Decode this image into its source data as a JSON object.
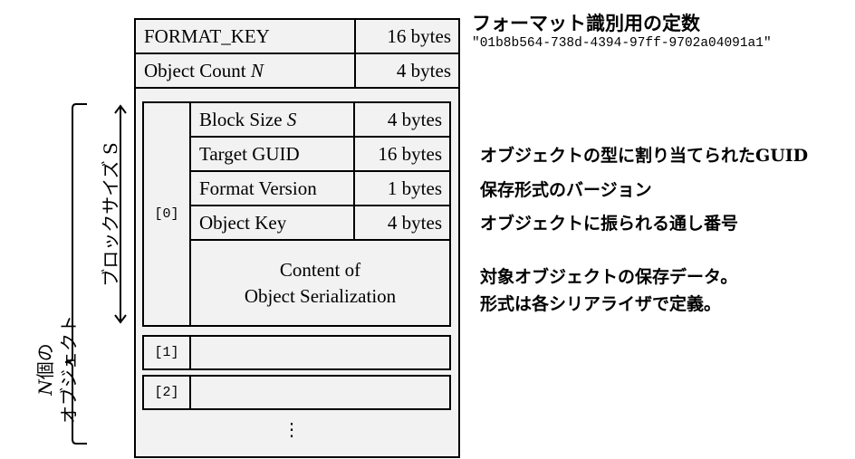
{
  "header_rows": [
    {
      "label": "FORMAT_KEY",
      "size": "16 bytes"
    },
    {
      "label": "Object Count ",
      "label_var": "N",
      "size": "4 bytes"
    }
  ],
  "block": {
    "index": "[0]",
    "rows": [
      {
        "label": "Block Size ",
        "label_var": "S",
        "size": "4 bytes"
      },
      {
        "label": "Target GUID",
        "size": "16 bytes"
      },
      {
        "label": "Format Version",
        "size": "1 bytes"
      },
      {
        "label": "Object Key",
        "size": "4 bytes"
      }
    ],
    "content_line1": "Content of",
    "content_line2": "Object Serialization"
  },
  "other_blocks": [
    "[1]",
    "[2]"
  ],
  "ellipsis": "⋮",
  "annotations": {
    "format_key_title": "フォーマット識別用の定数",
    "format_key_value": "\"01b8b564-738d-4394-97ff-9702a04091a1\"",
    "guid": "オブジェクトの型に割り当てられたGUID",
    "version": "保存形式のバージョン",
    "key": "オブジェクトに振られる通し番号",
    "content_line1": "対象オブジェクトの保存データ。",
    "content_line2": "形式は各シリアライザで定義。"
  },
  "side_labels": {
    "block_size": "ブロックサイズ S",
    "objects_var": "N",
    "objects_line1": "個の",
    "objects_line2": "オブジェクト"
  },
  "colors": {
    "fill": "#f2f2f2",
    "border": "#000000"
  }
}
